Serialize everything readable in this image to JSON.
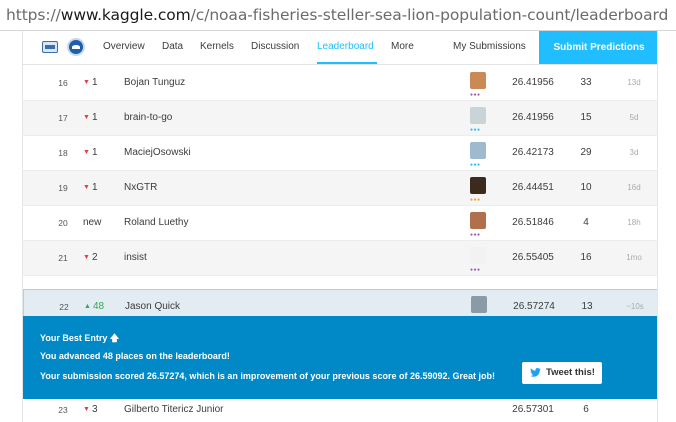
{
  "url": {
    "scheme": "https://",
    "host": "www.kaggle.com",
    "path": "/c/noaa-fisheries-steller-sea-lion-population-count/leaderboard"
  },
  "tabs": [
    {
      "label": "Overview"
    },
    {
      "label": "Data"
    },
    {
      "label": "Kernels"
    },
    {
      "label": "Discussion"
    },
    {
      "label": "Leaderboard",
      "active": true
    },
    {
      "label": "More"
    }
  ],
  "my_submissions": "My Submissions",
  "submit_label": "Submit Predictions",
  "rows": [
    {
      "rank": "16",
      "change_dir": "down",
      "change": "1",
      "team": "Bojan Tunguz",
      "score": "26.41956",
      "entries": "33",
      "last": "13d",
      "avatar_color": "#c98a56",
      "tier_color": "#9b59b6"
    },
    {
      "rank": "17",
      "change_dir": "down",
      "change": "1",
      "team": "brain-to-go",
      "score": "26.41956",
      "entries": "15",
      "last": "5d",
      "avatar_color": "#c9d3d8",
      "tier_color": "#20beff"
    },
    {
      "rank": "18",
      "change_dir": "down",
      "change": "1",
      "team": "MaciejOsowski",
      "score": "26.42173",
      "entries": "29",
      "last": "3d",
      "avatar_color": "#9fb9cf",
      "tier_color": "#20beff"
    },
    {
      "rank": "19",
      "change_dir": "down",
      "change": "1",
      "team": "NxGTR",
      "score": "26.44451",
      "entries": "10",
      "last": "16d",
      "avatar_color": "#3b2a1e",
      "tier_color": "#f0a020"
    },
    {
      "rank": "20",
      "change_dir": "none",
      "change": "new",
      "team": "Roland Luethy",
      "score": "26.51846",
      "entries": "4",
      "last": "18h",
      "avatar_color": "#b0704c",
      "tier_color": "#9b59b6"
    },
    {
      "rank": "21",
      "change_dir": "down",
      "change": "2",
      "team": "insist",
      "score": "26.55405",
      "entries": "16",
      "last": "1mo",
      "avatar_color": "#f2f2f2",
      "tier_color": "#9b59b6"
    },
    {
      "rank": "22",
      "change_dir": "up",
      "change": "48",
      "team": "Jason Quick",
      "score": "26.57274",
      "entries": "13",
      "last": "~10s",
      "avatar_color": "#8a9aa6",
      "tier_color": "#20beff"
    }
  ],
  "popup": {
    "title": "Your Best Entry",
    "title_icon": "arrow-up-icon",
    "line1": "You advanced 48 places on the leaderboard!",
    "line2": "Your submission scored 26.57274, which is an improvement of your previous score of 26.59092. Great job!",
    "tweet_label": "Tweet this!"
  },
  "bottom_row": {
    "rank": "23",
    "change": "3",
    "team": "Gilberto Titericz Junior",
    "score": "26.57301",
    "entries": "6"
  },
  "colors": {
    "accent": "#20beff",
    "popup_bg": "#0089c6",
    "down": "#e0424b",
    "up": "#32a852"
  }
}
